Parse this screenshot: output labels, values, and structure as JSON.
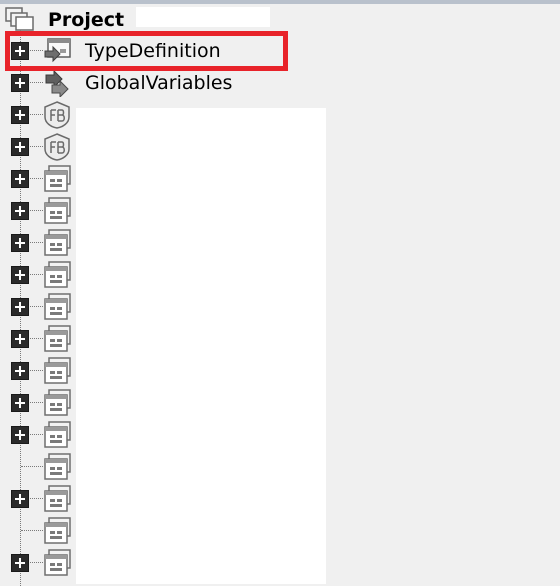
{
  "colors": {
    "background": "#f0f0f0",
    "highlight": "#e8232a",
    "redaction": "#ffffff",
    "tree_line": "#7a7a7a",
    "expander": "#2b2b2b"
  },
  "tree": {
    "root": {
      "label": "Project",
      "icon": "project-icon"
    },
    "items": [
      {
        "label": "TypeDefinition",
        "icon": "type-definition-icon",
        "expandable": true,
        "highlighted": true
      },
      {
        "label": "GlobalVariables",
        "icon": "global-variables-icon",
        "expandable": true
      },
      {
        "label": "",
        "icon": "function-block-icon",
        "expandable": true
      },
      {
        "label": "",
        "icon": "function-block-icon",
        "expandable": true
      },
      {
        "label": "",
        "icon": "program-icon",
        "expandable": true
      },
      {
        "label": "",
        "icon": "program-icon",
        "expandable": true
      },
      {
        "label": "",
        "icon": "program-icon",
        "expandable": true
      },
      {
        "label": "",
        "icon": "program-icon",
        "expandable": true
      },
      {
        "label": "",
        "icon": "program-icon",
        "expandable": true
      },
      {
        "label": "",
        "icon": "program-icon",
        "expandable": true
      },
      {
        "label": "",
        "icon": "program-icon",
        "expandable": true
      },
      {
        "label": "",
        "icon": "program-icon",
        "expandable": true
      },
      {
        "label": "",
        "icon": "program-icon",
        "expandable": true
      },
      {
        "label": "",
        "icon": "program-icon",
        "expandable": false
      },
      {
        "label": "",
        "icon": "program-icon",
        "expandable": true
      },
      {
        "label": "",
        "icon": "program-icon",
        "expandable": false
      },
      {
        "label": "",
        "icon": "program-icon",
        "expandable": true
      }
    ]
  }
}
